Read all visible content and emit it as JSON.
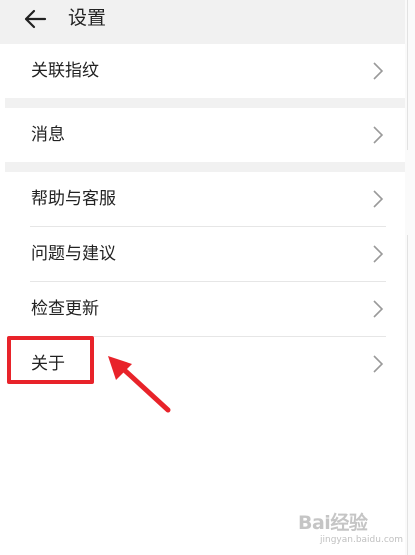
{
  "header": {
    "title": "设置"
  },
  "rows": [
    {
      "label": "关联指纹"
    },
    {
      "label": "消息"
    },
    {
      "label": "帮助与客服"
    },
    {
      "label": "问题与建议"
    },
    {
      "label": "检查更新"
    },
    {
      "label": "关于"
    }
  ],
  "watermark": {
    "brand": "Bai经验",
    "url": "jingyan.baidu.com"
  },
  "colors": {
    "header_bg": "#f1f1f1",
    "highlight": "#e8232a",
    "text": "#222222",
    "chevron": "#9a9a9a"
  },
  "icons": {
    "back": "arrow-left-icon",
    "chevron": "chevron-right-icon",
    "annotation": "red-arrow-icon"
  }
}
